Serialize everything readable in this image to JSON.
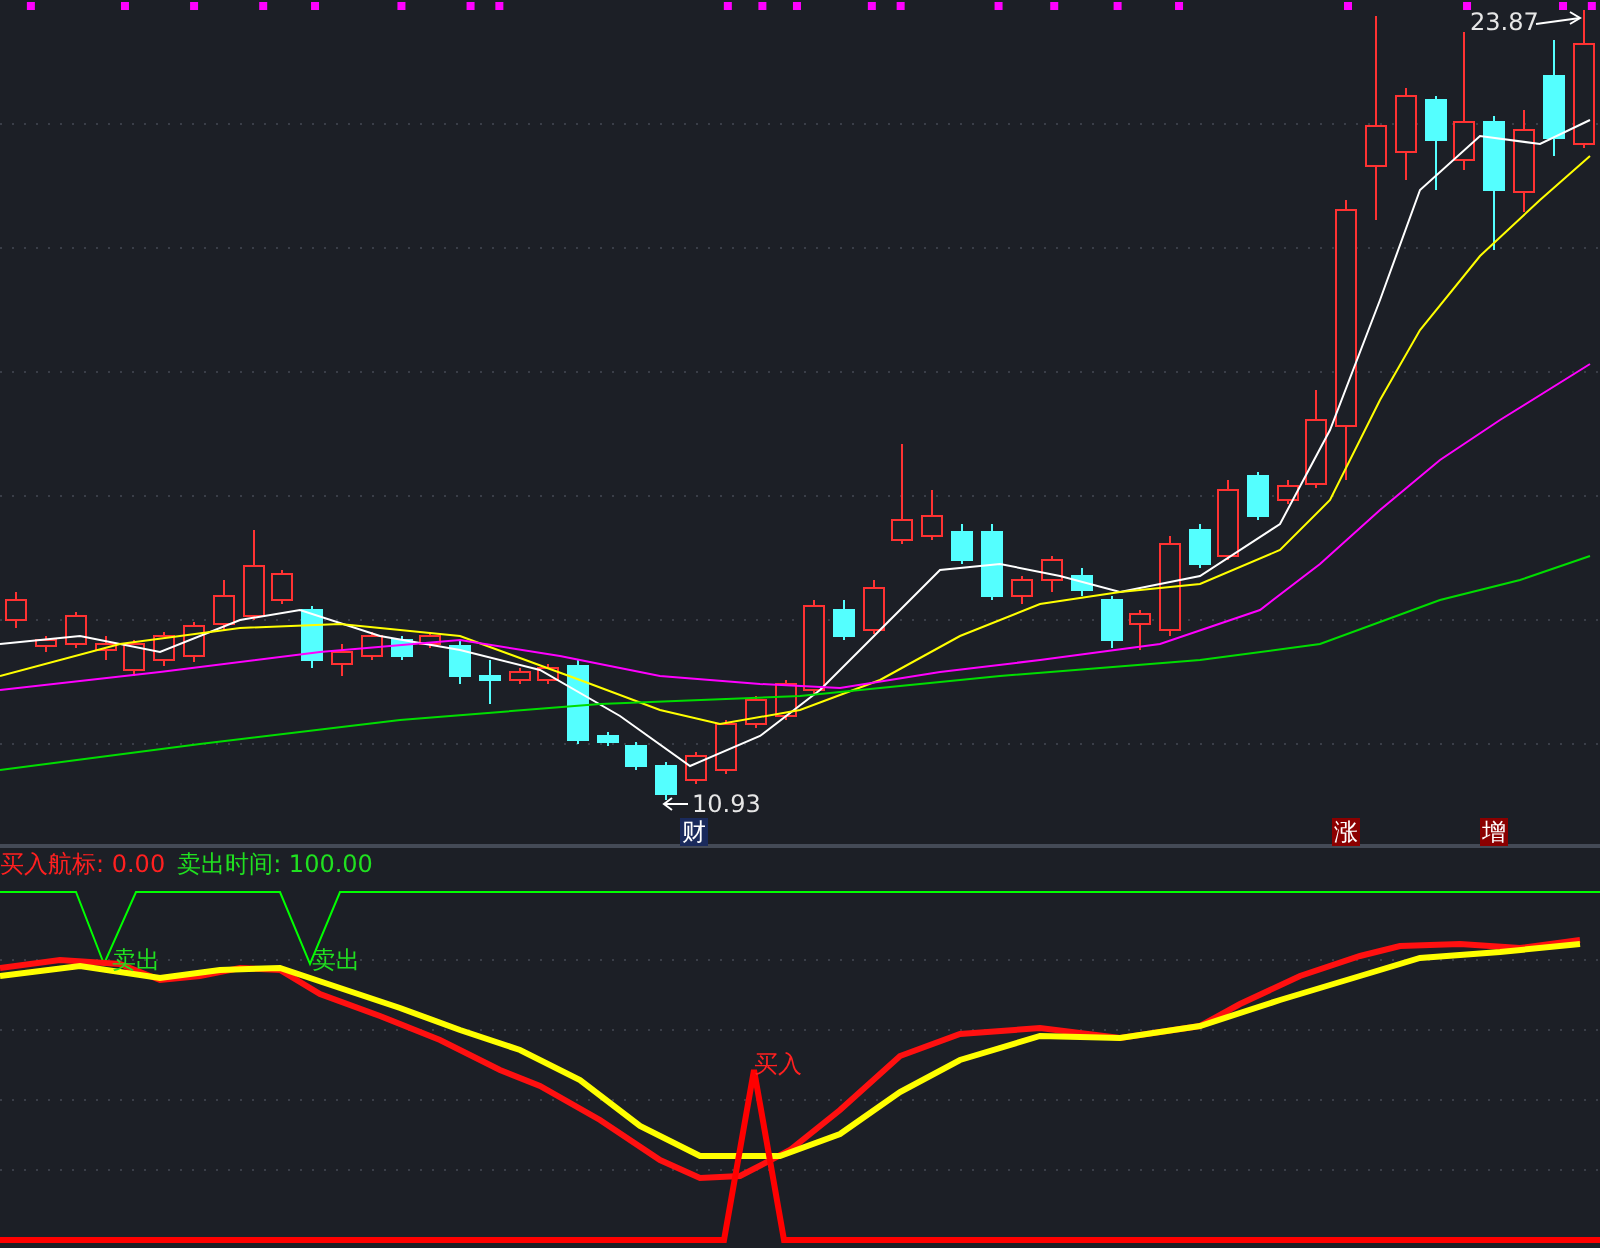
{
  "price_chart": {
    "high_label": "23.87",
    "low_label": "10.93",
    "events": [
      {
        "text": "财",
        "color": "#1a2a5c"
      },
      {
        "text": "涨",
        "color": "#8b0000"
      },
      {
        "text": "增",
        "color": "#8b0000"
      }
    ]
  },
  "indicator": {
    "legend": [
      {
        "kind": "buy",
        "text": "买入航标: 0.00"
      },
      {
        "kind": "sell",
        "text": "卖出时间: 100.00"
      }
    ],
    "signals": [
      {
        "kind": "sell",
        "text": "卖出"
      },
      {
        "kind": "sell",
        "text": "卖出"
      },
      {
        "kind": "buy",
        "text": "买入"
      }
    ]
  }
}
